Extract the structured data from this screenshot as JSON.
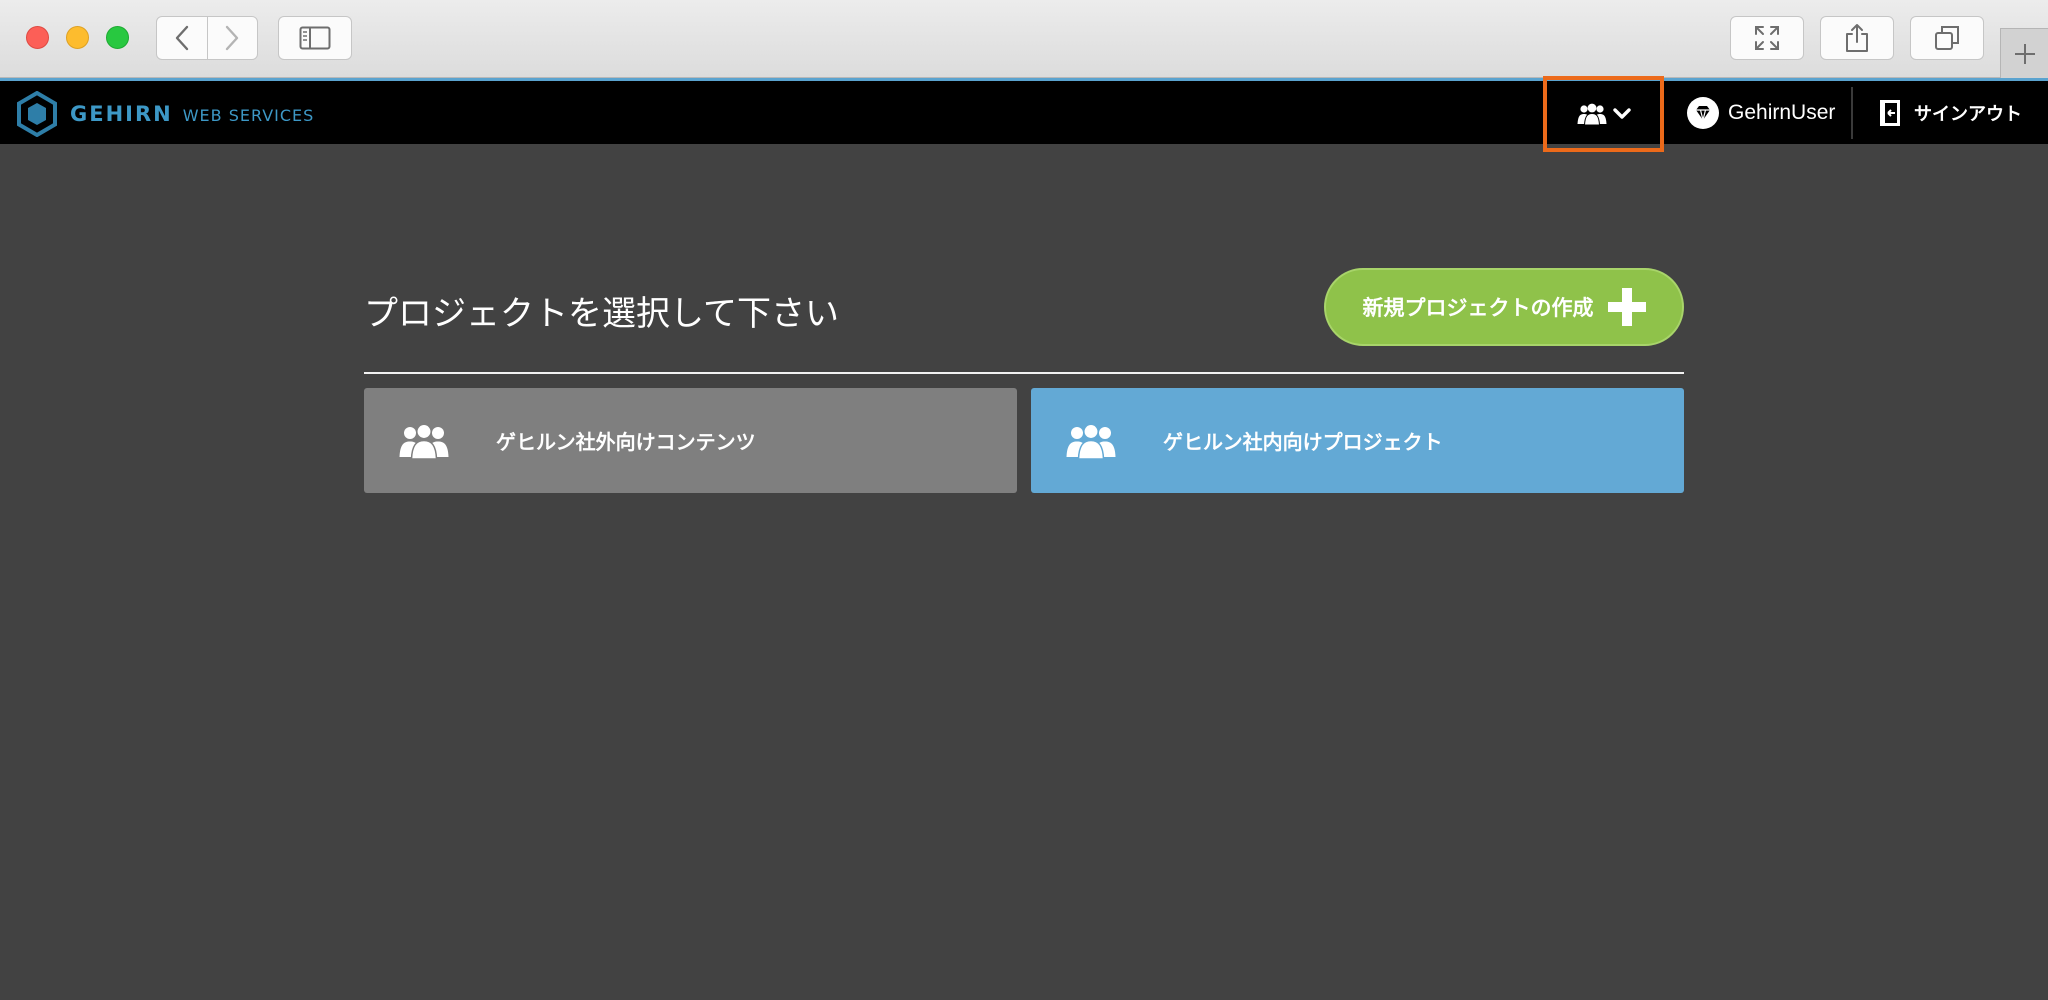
{
  "header": {
    "logo_main": "GEHIRN",
    "logo_sub": "WEB SERVICES",
    "user_name": "GehirnUser",
    "signout_label": "サインアウト"
  },
  "main": {
    "heading": "プロジェクトを選択して下さい",
    "create_button_label": "新規プロジェクトの作成"
  },
  "projects": [
    {
      "name": "ゲヒルン社外向けコンテンツ"
    },
    {
      "name": "ゲヒルン社内向けプロジェクト"
    }
  ],
  "colors": {
    "highlight": "#ec6a1a",
    "create_button": "#8fc24a",
    "card_external": "#7f7f7f",
    "card_internal": "#63a9d5",
    "brand": "#3d98c6",
    "background": "#424242"
  },
  "icons": {
    "team_menu": "users-icon",
    "user_avatar": "diamond-avatar-icon",
    "signout": "door-exit-icon",
    "create": "plus-icon",
    "project": "users-icon"
  }
}
